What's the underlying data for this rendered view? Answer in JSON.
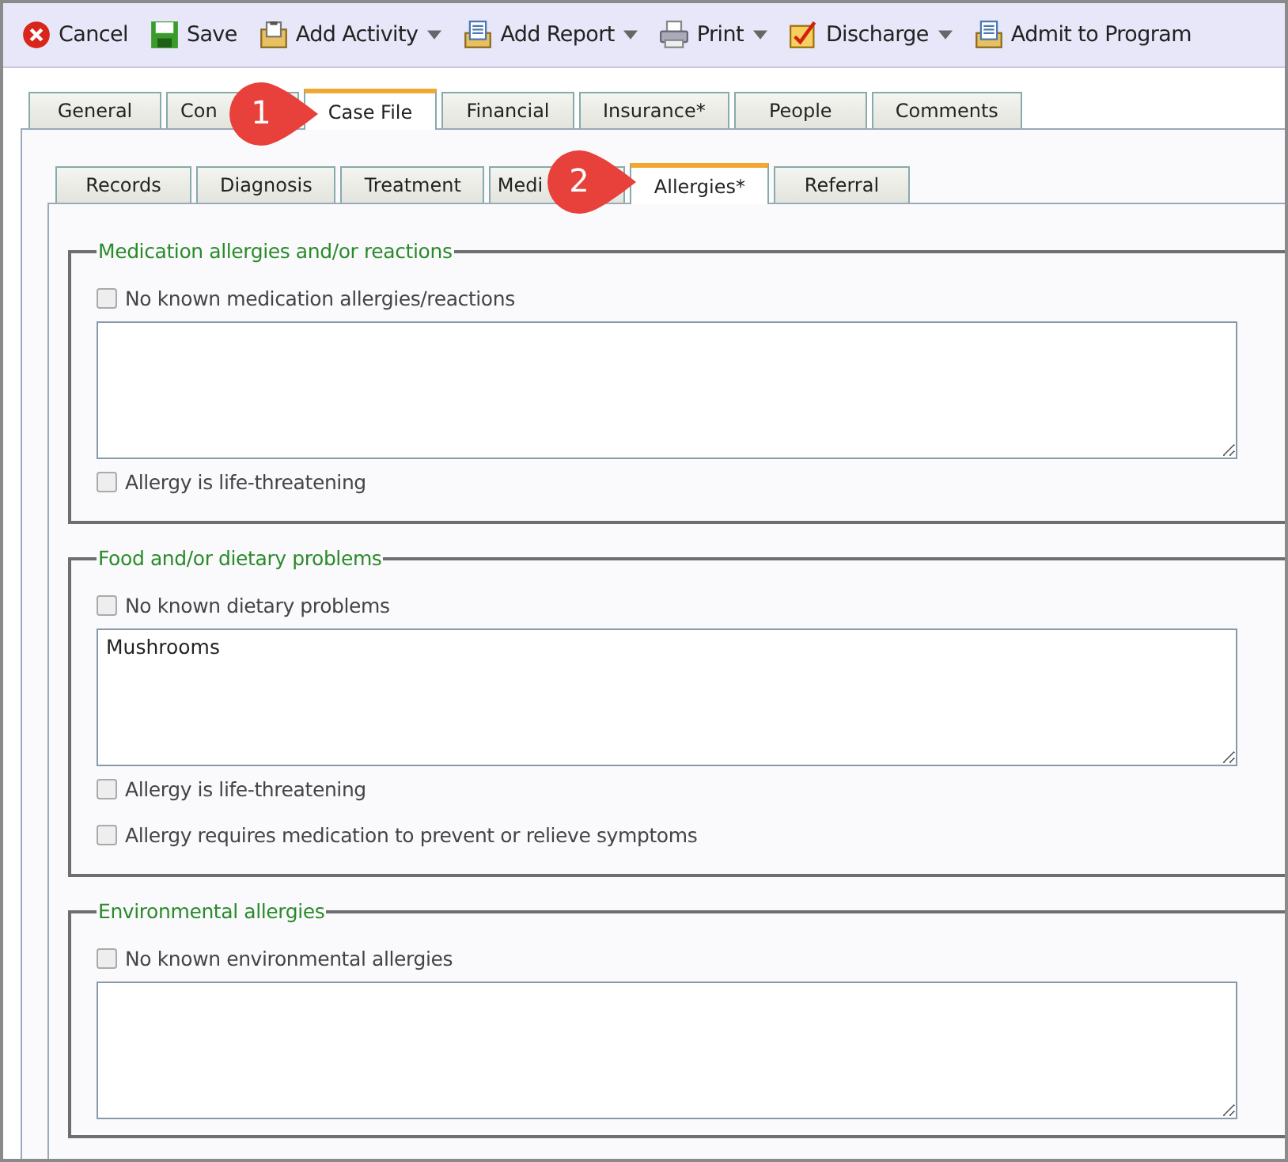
{
  "toolbar": [
    {
      "label": "Cancel",
      "dropdown": false
    },
    {
      "label": "Save",
      "dropdown": false
    },
    {
      "label": "Add Activity",
      "dropdown": true
    },
    {
      "label": "Add Report",
      "dropdown": true
    },
    {
      "label": "Print",
      "dropdown": true
    },
    {
      "label": "Discharge",
      "dropdown": true
    },
    {
      "label": "Admit to Program",
      "dropdown": false
    }
  ],
  "tabs": [
    {
      "label": "General",
      "selected": false
    },
    {
      "label": "Con",
      "selected": false,
      "kind": "cut"
    },
    {
      "label": "Case File",
      "selected": true
    },
    {
      "label": "Financial",
      "selected": false
    },
    {
      "label": "Insurance*",
      "selected": false
    },
    {
      "label": "People",
      "selected": false
    },
    {
      "label": "Comments",
      "selected": false
    }
  ],
  "subtabs": [
    {
      "label": "Records",
      "selected": false
    },
    {
      "label": "Diagnosis",
      "selected": false
    },
    {
      "label": "Treatment",
      "selected": false
    },
    {
      "label": "Medi",
      "selected": false,
      "kind": "cut"
    },
    {
      "label": "Allergies*",
      "selected": true
    },
    {
      "label": "Referral",
      "selected": false
    }
  ],
  "callouts": [
    "1",
    "2"
  ],
  "sections": [
    {
      "title": "Medication allergies and/or reactions",
      "items": [
        {
          "kind": "checkbox",
          "label": "No known medication allergies/reactions",
          "checked": false
        },
        {
          "kind": "textarea"
        },
        {
          "kind": "checkbox",
          "label": "Allergy is life-threatening",
          "checked": false
        }
      ]
    },
    {
      "title": "Food and/or dietary problems",
      "items": [
        {
          "kind": "checkbox",
          "label": "No known dietary problems",
          "checked": false
        },
        {
          "kind": "textarea",
          "value": "Mushrooms"
        },
        {
          "kind": "checkbox",
          "label": "Allergy is life-threatening",
          "checked": false
        },
        {
          "kind": "checkbox",
          "label": "Allergy requires medication to prevent or relieve symptoms",
          "checked": false
        }
      ]
    },
    {
      "title": "Environmental allergies",
      "items": [
        {
          "kind": "checkbox",
          "label": "No known environmental allergies",
          "checked": false
        },
        {
          "kind": "textarea"
        }
      ]
    }
  ]
}
